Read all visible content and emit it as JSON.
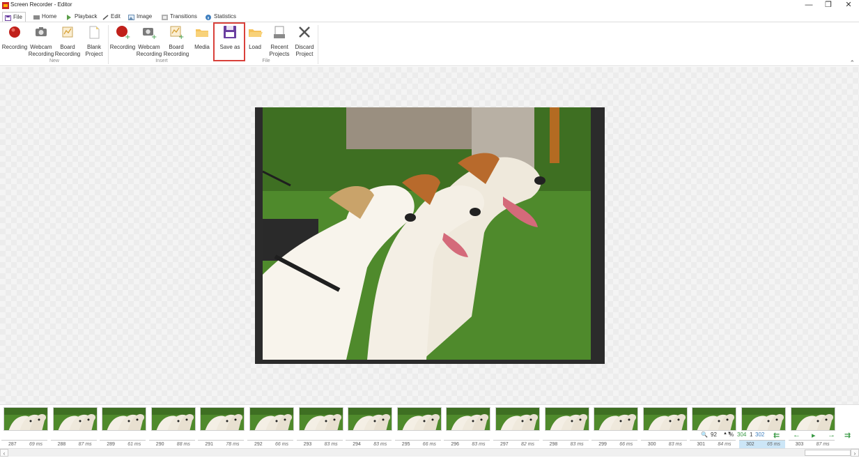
{
  "window": {
    "title": "Screen Recorder - Editor",
    "controls": [
      "—",
      "❐",
      "✕"
    ]
  },
  "tabs": [
    {
      "label": "File",
      "icon": "save-icon",
      "active": true
    },
    {
      "label": "Home",
      "icon": "home-icon",
      "active": false
    },
    {
      "label": "Playback",
      "icon": "play-icon",
      "active": false
    },
    {
      "label": "Edit",
      "icon": "pencil-icon",
      "active": false
    },
    {
      "label": "Image",
      "icon": "image-icon",
      "active": false
    },
    {
      "label": "Transitions",
      "icon": "transitions-icon",
      "active": false
    },
    {
      "label": "Statistics",
      "icon": "info-icon",
      "active": false
    }
  ],
  "ribbon": {
    "groups": {
      "new": "New",
      "insert": "Insert",
      "file": "File"
    },
    "new_buttons": [
      {
        "label": "Recording",
        "icon": "record-icon"
      },
      {
        "label": "Webcam\nRecording",
        "icon": "camera-icon"
      },
      {
        "label": "Board\nRecording",
        "icon": "board-icon"
      },
      {
        "label": "Blank\nProject",
        "icon": "blank-page-icon"
      }
    ],
    "insert_buttons": [
      {
        "label": "Recording",
        "icon": "record-add-icon"
      },
      {
        "label": "Webcam\nRecording",
        "icon": "camera-add-icon"
      },
      {
        "label": "Board\nRecording",
        "icon": "board-add-icon"
      },
      {
        "label": "Media",
        "icon": "folder-icon"
      }
    ],
    "file_buttons": [
      {
        "label": "Save as",
        "icon": "floppy-icon"
      },
      {
        "label": "Load",
        "icon": "folder-open-icon"
      },
      {
        "label": "Recent\nProjects",
        "icon": "recent-icon"
      },
      {
        "label": "Discard\nProject",
        "icon": "x-icon"
      }
    ],
    "collapse": "⌃"
  },
  "timeline": {
    "frames": [
      {
        "num": "287",
        "ms": "69 ms"
      },
      {
        "num": "288",
        "ms": "87 ms"
      },
      {
        "num": "289",
        "ms": "61 ms"
      },
      {
        "num": "290",
        "ms": "88 ms"
      },
      {
        "num": "291",
        "ms": "78 ms"
      },
      {
        "num": "292",
        "ms": "66 ms"
      },
      {
        "num": "293",
        "ms": "83 ms"
      },
      {
        "num": "294",
        "ms": "83 ms"
      },
      {
        "num": "295",
        "ms": "66 ms"
      },
      {
        "num": "296",
        "ms": "83 ms"
      },
      {
        "num": "297",
        "ms": "82 ms"
      },
      {
        "num": "298",
        "ms": "83 ms"
      },
      {
        "num": "299",
        "ms": "66 ms"
      },
      {
        "num": "300",
        "ms": "83 ms"
      },
      {
        "num": "301",
        "ms": "84 ms"
      },
      {
        "num": "302",
        "ms": "65 ms"
      },
      {
        "num": "303",
        "ms": "87 ms"
      }
    ],
    "selected_frame": "302",
    "zoom_value": "92",
    "zoom_unit": "%",
    "total_frames": "304",
    "selected_count": "1",
    "current_frame": "302"
  },
  "colors": {
    "highlight": "#d9403a",
    "accent_green": "#3a9a45",
    "selected_bg": "#cce6f7"
  }
}
